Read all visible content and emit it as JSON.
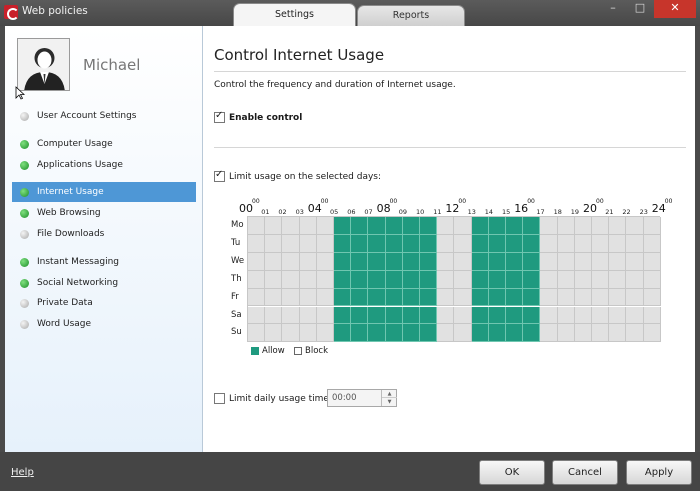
{
  "window": {
    "title": "Web policies",
    "tabs": [
      {
        "label": "Settings",
        "active": true
      },
      {
        "label": "Reports",
        "active": false
      }
    ],
    "controls": {
      "minimize": "–",
      "maximize": "□",
      "close": "✕"
    }
  },
  "sidebar": {
    "user_name": "Michael",
    "items": [
      {
        "label": "User Account Settings",
        "status": "gray"
      },
      {
        "label": "Computer Usage",
        "status": "green"
      },
      {
        "label": "Applications Usage",
        "status": "green"
      },
      {
        "label": "Internet Usage",
        "status": "green",
        "active": true
      },
      {
        "label": "Web Browsing",
        "status": "green"
      },
      {
        "label": "File Downloads",
        "status": "gray"
      },
      {
        "label": "Instant Messaging",
        "status": "green"
      },
      {
        "label": "Social Networking",
        "status": "green"
      },
      {
        "label": "Private Data",
        "status": "gray"
      },
      {
        "label": "Word Usage",
        "status": "gray"
      }
    ]
  },
  "main": {
    "title": "Control Internet Usage",
    "description": "Control the frequency and duration of Internet usage.",
    "enable_control": {
      "label": "Enable control",
      "checked": true
    },
    "limit_days": {
      "label": "Limit usage on the selected days:",
      "checked": true
    },
    "schedule": {
      "days": [
        "Mo",
        "Tu",
        "We",
        "Th",
        "Fr",
        "Sa",
        "Su"
      ],
      "hour_labels_big": [
        "00",
        "04",
        "08",
        "12",
        "16",
        "20",
        "24"
      ],
      "hour_labels_sup": "00",
      "hour_labels_small": [
        "01",
        "02",
        "03",
        "05",
        "06",
        "07",
        "09",
        "10",
        "11",
        "13",
        "14",
        "15",
        "17",
        "18",
        "19",
        "21",
        "22",
        "23"
      ],
      "allowed_hours": [
        5,
        6,
        7,
        8,
        9,
        10,
        13,
        14,
        15,
        16
      ]
    },
    "legend": {
      "allow": "Allow",
      "block": "Block"
    },
    "limit_daily": {
      "label": "Limit daily usage time:",
      "checked": false,
      "value": "00:00"
    }
  },
  "footer": {
    "help": "Help",
    "ok": "OK",
    "cancel": "Cancel",
    "apply": "Apply"
  },
  "colors": {
    "allow": "#1f9a7f",
    "block": "#e1e1e1",
    "active_nav": "#4e97d6"
  }
}
